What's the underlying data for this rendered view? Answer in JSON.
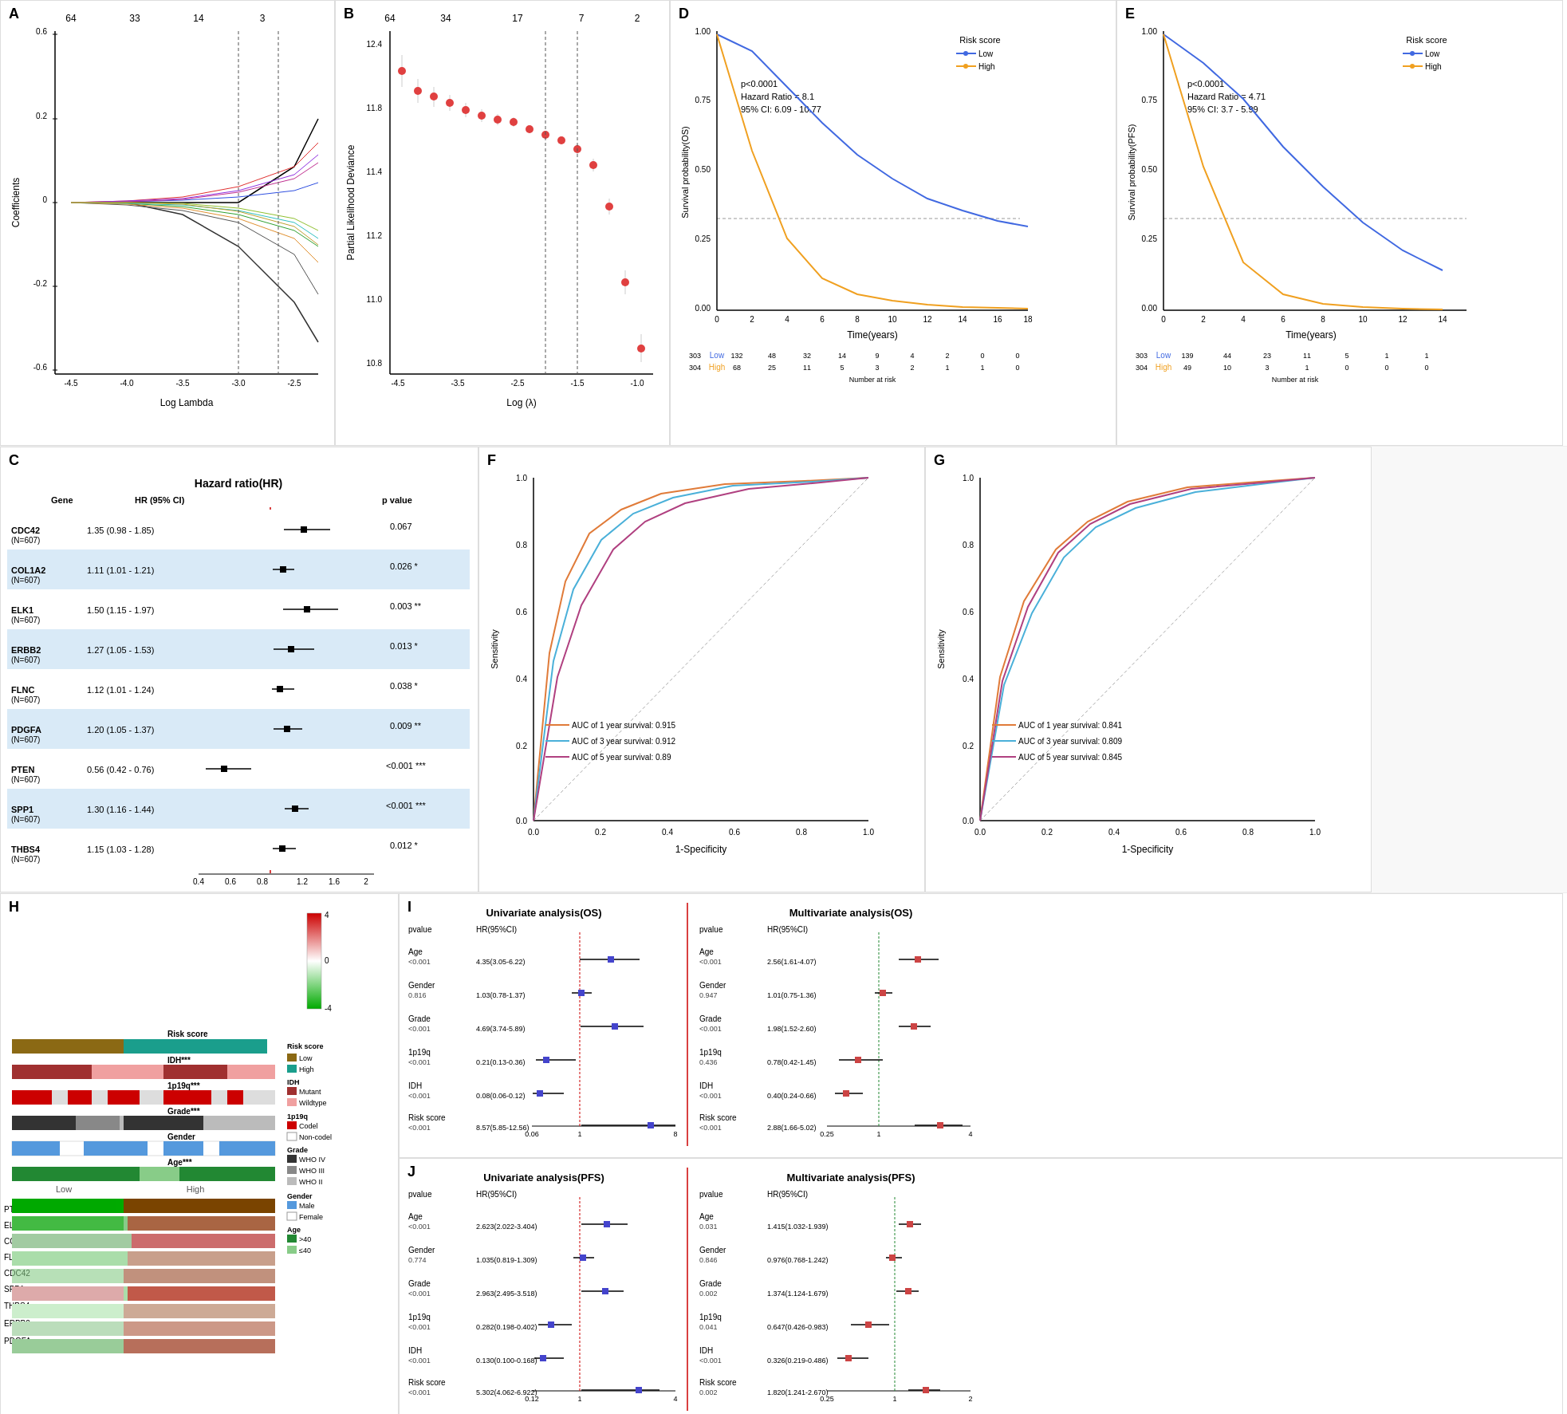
{
  "panels": {
    "A": {
      "label": "A",
      "xaxis": "Log Lambda",
      "yaxis": "Coefficients",
      "top_numbers": [
        "64",
        "33",
        "14",
        "3"
      ]
    },
    "B": {
      "label": "B",
      "xaxis": "Log (λ)",
      "yaxis": "Partial Likelihood Deviance",
      "top_numbers": [
        "64",
        "34",
        "17",
        "7",
        "2"
      ]
    },
    "C": {
      "label": "C",
      "title": "Hazard ratio(HR)",
      "genes": [
        {
          "name": "CDC42",
          "n": "N=607",
          "hr": "1.35 (0.98 - 1.85)",
          "p": "0.067",
          "sig": ""
        },
        {
          "name": "COL1A2",
          "n": "N=607",
          "hr": "1.11 (1.01 - 1.21)",
          "p": "0.026",
          "sig": "*"
        },
        {
          "name": "ELK1",
          "n": "N=607",
          "hr": "1.50 (1.15 - 1.97)",
          "p": "0.003",
          "sig": "**"
        },
        {
          "name": "ERBB2",
          "n": "N=607",
          "hr": "1.27 (1.05 - 1.53)",
          "p": "0.013",
          "sig": "*"
        },
        {
          "name": "FLNC",
          "n": "N=607",
          "hr": "1.12 (1.01 - 1.24)",
          "p": "0.038",
          "sig": "*"
        },
        {
          "name": "PDGFA",
          "n": "N=607",
          "hr": "1.20 (1.05 - 1.37)",
          "p": "0.009",
          "sig": "**"
        },
        {
          "name": "PTEN",
          "n": "N=607",
          "hr": "0.56 (0.42 - 0.76)",
          "p": "<0.001",
          "sig": "***"
        },
        {
          "name": "SPP1",
          "n": "N=607",
          "hr": "1.30 (1.16 - 1.44)",
          "p": "<0.001",
          "sig": "***"
        },
        {
          "name": "THBS4",
          "n": "N=607",
          "hr": "1.15 (1.03 - 1.28)",
          "p": "0.012",
          "sig": "*"
        }
      ]
    },
    "D": {
      "label": "D",
      "title": "Risk score",
      "xaxis": "Time(years)",
      "yaxis": "Survival probability(OS)",
      "pvalue": "p<0.0001",
      "hazard_ratio": "Hazard Ratio = 8.1",
      "ci": "95% CI: 6.09 - 10.77",
      "low_label": "Low",
      "high_label": "High",
      "at_risk": {
        "low": [
          "303",
          "132",
          "48",
          "32",
          "14",
          "9",
          "4",
          "2",
          "0",
          "0"
        ],
        "high": [
          "304",
          "68",
          "25",
          "11",
          "5",
          "3",
          "2",
          "1",
          "1",
          "0"
        ]
      },
      "time_points": [
        "0",
        "2",
        "4",
        "6",
        "8",
        "10",
        "12",
        "14",
        "16",
        "18"
      ]
    },
    "E": {
      "label": "E",
      "title": "Risk score",
      "xaxis": "Time(years)",
      "yaxis": "Survival probability(PFS)",
      "pvalue": "p<0.0001",
      "hazard_ratio": "Hazard Ratio = 4.71",
      "ci": "95% CI: 3.7 - 5.99",
      "low_label": "Low",
      "high_label": "High",
      "at_risk": {
        "low": [
          "303",
          "139",
          "44",
          "23",
          "11",
          "5",
          "1",
          "1"
        ],
        "high": [
          "304",
          "49",
          "10",
          "3",
          "1",
          "0",
          "0",
          "0"
        ]
      },
      "time_points": [
        "0",
        "2",
        "4",
        "6",
        "8",
        "10",
        "12",
        "14"
      ]
    },
    "F": {
      "label": "F",
      "xaxis": "1-Specificity",
      "yaxis": "Sensitivity",
      "legend": [
        {
          "label": "AUC of 1 year survival: 0.915",
          "color": "#e07b39"
        },
        {
          "label": "AUC of 3 year survival: 0.912",
          "color": "#4ab0d9"
        },
        {
          "label": "AUC of 5 year survival: 0.89",
          "color": "#b04080"
        }
      ]
    },
    "G": {
      "label": "G",
      "xaxis": "1-Specificity",
      "yaxis": "Sensitivity",
      "legend": [
        {
          "label": "AUC of 1 year survival: 0.841",
          "color": "#e07b39"
        },
        {
          "label": "AUC of 3 year survival: 0.809",
          "color": "#4ab0d9"
        },
        {
          "label": "AUC of 5 year survival: 0.845",
          "color": "#b04080"
        }
      ]
    },
    "H": {
      "label": "H",
      "tracks": [
        "Risk score",
        "IDH***",
        "1p19q***",
        "Grade***",
        "Gender",
        "Age***"
      ],
      "genes": [
        "PTEN",
        "ELK1",
        "COL1A2",
        "FLNC",
        "CDC42",
        "SPP1",
        "THBS4",
        "ERBB2",
        "PDGFA"
      ],
      "legend": {
        "risk_score": {
          "label": "Risk score",
          "items": [
            {
              "color": "#8B6914",
              "text": "Low"
            },
            {
              "color": "#1a9e8c",
              "text": "High"
            }
          ]
        },
        "idh": {
          "label": "IDH",
          "items": [
            {
              "color": "#a03030",
              "text": "Mutant"
            },
            {
              "color": "#f0a0a0",
              "text": "Wildtype"
            }
          ]
        },
        "p19q": {
          "label": "1p19q",
          "items": [
            {
              "color": "#cc0000",
              "text": "Codel"
            },
            {
              "color": "#ffffff",
              "text": "Non-codel"
            }
          ]
        },
        "grade": {
          "label": "Grade",
          "items": [
            {
              "color": "#333333",
              "text": "WHO IV"
            },
            {
              "color": "#888888",
              "text": "WHO III"
            },
            {
              "color": "#bbbbbb",
              "text": "WHO II"
            }
          ]
        },
        "gender": {
          "label": "Gender",
          "items": [
            {
              "color": "#5599dd",
              "text": "Male"
            },
            {
              "color": "#ffffff",
              "text": "Female"
            }
          ]
        },
        "age": {
          "label": "Age",
          "items": [
            {
              "color": "#228833",
              "text": ">40"
            },
            {
              "color": "#88cc88",
              "text": "≤40"
            }
          ]
        }
      },
      "colorbar": {
        "max": "4",
        "mid": "0",
        "min": "-4"
      }
    },
    "I": {
      "label": "I",
      "univariate_title": "Univariate analysis(OS)",
      "multivariate_title": "Multivariate analysis(OS)",
      "rows": [
        {
          "var": "Age",
          "uni_p": "<0.001",
          "uni_hr": "4.35(3.05-6.22)",
          "multi_p": "<0.001",
          "multi_hr": "2.56(1.61-4.07)"
        },
        {
          "var": "Gender",
          "uni_p": "0.816",
          "uni_hr": "1.03(0.78-1.37)",
          "multi_p": "0.947",
          "multi_hr": "1.01(0.75-1.36)"
        },
        {
          "var": "Grade",
          "uni_p": "<0.001",
          "uni_hr": "4.69(3.74-5.89)",
          "multi_p": "<0.001",
          "multi_hr": "1.98(1.52-2.60)"
        },
        {
          "var": "1p19q",
          "uni_p": "<0.001",
          "uni_hr": "0.21(0.13-0.36)",
          "multi_p": "0.436",
          "multi_hr": "0.78(0.42-1.45)"
        },
        {
          "var": "IDH",
          "uni_p": "<0.001",
          "uni_hr": "0.08(0.06-0.12)",
          "multi_p": "<0.001",
          "multi_hr": "0.40(0.24-0.66)"
        },
        {
          "var": "Risk score",
          "uni_p": "<0.001",
          "uni_hr": "8.57(5.85-12.56)",
          "multi_p": "<0.001",
          "multi_hr": "2.88(1.66-5.02)"
        }
      ],
      "uni_xaxis": [
        "0.06",
        "1",
        "8"
      ],
      "multi_xaxis": [
        "0.25",
        "1",
        "4"
      ]
    },
    "J": {
      "label": "J",
      "univariate_title": "Univariate analysis(PFS)",
      "multivariate_title": "Multivariate analysis(PFS)",
      "rows": [
        {
          "var": "Age",
          "uni_p": "<0.001",
          "uni_hr": "2.623(2.022-3.404)",
          "multi_p": "0.031",
          "multi_hr": "1.415(1.032-1.939)"
        },
        {
          "var": "Gender",
          "uni_p": "0.774",
          "uni_hr": "1.035(0.819-1.309)",
          "multi_p": "0.846",
          "multi_hr": "0.976(0.768-1.242)"
        },
        {
          "var": "Grade",
          "uni_p": "<0.001",
          "uni_hr": "2.963(2.495-3.518)",
          "multi_p": "0.002",
          "multi_hr": "1.374(1.124-1.679)"
        },
        {
          "var": "1p19q",
          "uni_p": "<0.001",
          "uni_hr": "0.282(0.198-0.402)",
          "multi_p": "0.041",
          "multi_hr": "0.647(0.426-0.983)"
        },
        {
          "var": "IDH",
          "uni_p": "<0.001",
          "uni_hr": "0.130(0.100-0.168)",
          "multi_p": "<0.001",
          "multi_hr": "0.326(0.219-0.486)"
        },
        {
          "var": "Risk score",
          "uni_p": "<0.001",
          "uni_hr": "5.302(4.062-6.922)",
          "multi_p": "0.002",
          "multi_hr": "1.820(1.241-2.670)"
        }
      ],
      "uni_xaxis": [
        "0.12",
        "1",
        "4"
      ],
      "multi_xaxis": [
        "0.25",
        "1",
        "2"
      ]
    }
  }
}
